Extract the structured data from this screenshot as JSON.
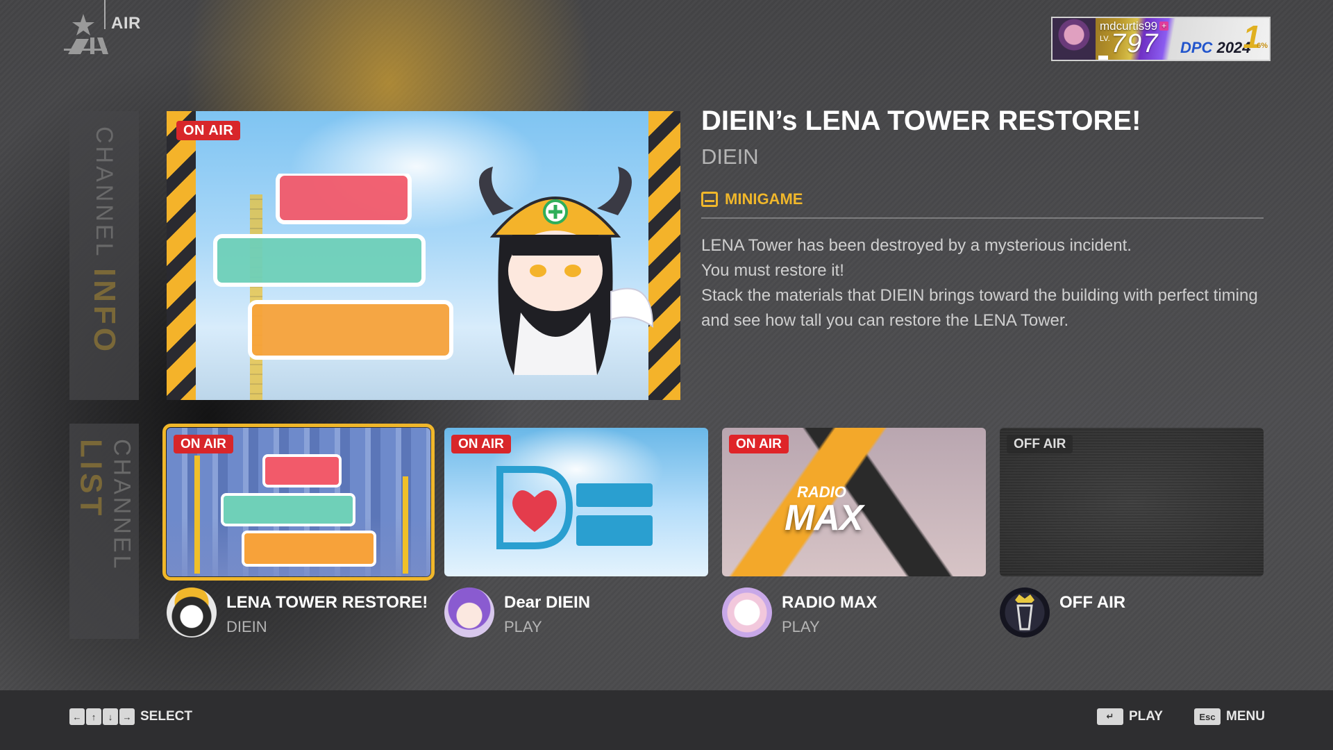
{
  "header": {
    "app_title": "AIR",
    "profile": {
      "username": "mdcurtis99",
      "level_label": "LV.",
      "level": "797",
      "event_prefix": "DPC",
      "event_year": "2024",
      "rank": "1",
      "percent": "6%"
    }
  },
  "side_tabs": {
    "info": {
      "light": "CHANNEL",
      "bold": "INFO"
    },
    "list": {
      "light": "CHANNEL",
      "bold": "LIST"
    }
  },
  "featured": {
    "badge": "ON AIR",
    "title": "DIEIN’s LENA TOWER RESTORE!",
    "creator": "DIEIN",
    "category": "MINIGAME",
    "description": [
      "LENA Tower has been destroyed by a mysterious incident.",
      "You must restore it!",
      "Stack the materials that DIEIN brings toward the building with perfect timing and see how tall you can restore the LENA Tower."
    ]
  },
  "channels": [
    {
      "badge": "ON AIR",
      "name": "LENA TOWER RESTORE!",
      "sub": "DIEIN",
      "selected": true
    },
    {
      "badge": "ON AIR",
      "name": "Dear DIEIN",
      "sub": "PLAY",
      "logo_text": "DEAR DIEIN"
    },
    {
      "badge": "ON AIR",
      "name": "RADIO MAX",
      "sub": "PLAY",
      "logo_top": "RADIO",
      "logo_bottom": "MAX"
    },
    {
      "badge": "OFF AIR",
      "name": "OFF AIR",
      "sub": ""
    }
  ],
  "footer": {
    "select_label": "SELECT",
    "play_key": "↵",
    "play_label": "PLAY",
    "menu_key": "Esc",
    "menu_label": "MENU",
    "arrow_keys": [
      "←",
      "↑",
      "↓",
      "→"
    ]
  },
  "colors": {
    "accent": "#f0b72b",
    "on_air": "#d8262a",
    "background": "#4a4a4c"
  }
}
